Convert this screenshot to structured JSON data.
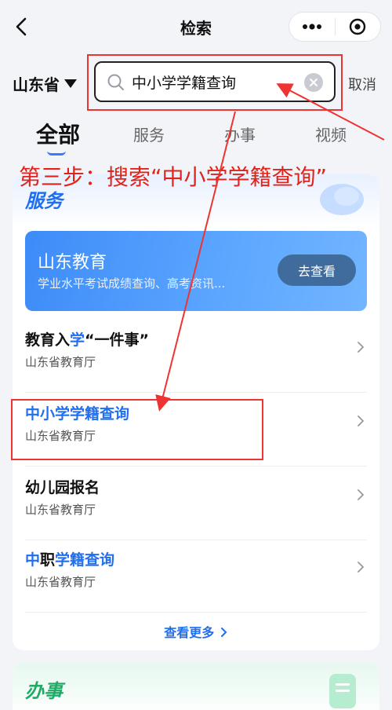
{
  "header": {
    "title": "检索"
  },
  "search": {
    "province": "山东省",
    "value": "中小学学籍查询",
    "cancel": "取消"
  },
  "tabs": [
    {
      "label": "全部",
      "active": true
    },
    {
      "label": "服务",
      "active": false
    },
    {
      "label": "办事",
      "active": false
    },
    {
      "label": "视频",
      "active": false
    }
  ],
  "annotation": {
    "step": "第三步：搜索“中小学学籍查询”",
    "color": "#e0241b"
  },
  "service": {
    "heading": "服务",
    "banner": {
      "title": "山东教育",
      "subtitle": "学业水平考试成绩查询、高考资讯...",
      "button": "去查看"
    },
    "items": [
      {
        "name_pre": "教育入",
        "name_hl": "学",
        "name_post": "“一件事”",
        "org": "山东省教育厅"
      },
      {
        "name_pre": "",
        "name_hl": "中小学学籍查询",
        "name_post": "",
        "org": "山东省教育厅"
      },
      {
        "name_pre": "幼儿园报名",
        "name_hl": "",
        "name_post": "",
        "org": "山东省教育厅"
      },
      {
        "name_pre": "",
        "name_hl": "中",
        "name_mid": "职",
        "name_post": "学籍查询",
        "org": "山东省教育厅"
      }
    ],
    "more": "查看更多"
  },
  "affairs": {
    "heading": "办事"
  },
  "colors": {
    "accent": "#1f6ff0",
    "highlight_red": "#e33333"
  }
}
